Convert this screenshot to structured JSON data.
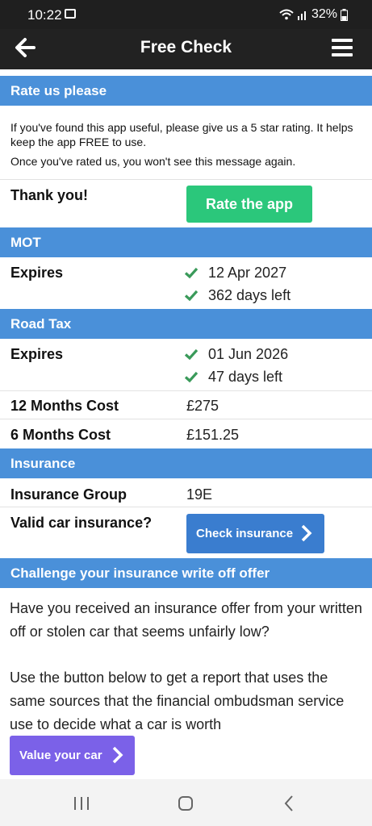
{
  "status_bar": {
    "time": "10:22",
    "battery": "32%"
  },
  "toolbar": {
    "title": "Free Check"
  },
  "rate": {
    "header": "Rate us please",
    "line1": "If you've found this app useful, please give us a 5 star rating. It helps keep the app FREE to use.",
    "line2": "Once you've rated us, you won't see this message again.",
    "thanks": "Thank you!",
    "button": "Rate the app"
  },
  "mot": {
    "header": "MOT",
    "expires_label": "Expires",
    "expiry_date": "12 Apr 2027",
    "days_left": "362 days left"
  },
  "road_tax": {
    "header": "Road Tax",
    "expires_label": "Expires",
    "expiry_date": "01 Jun 2026",
    "days_left": "47 days left",
    "cost12_label": "12 Months Cost",
    "cost12_value": "£275",
    "cost6_label": "6 Months Cost",
    "cost6_value": "£151.25"
  },
  "insurance": {
    "header": "Insurance",
    "group_label": "Insurance Group",
    "group_value": "19E",
    "valid_label": "Valid car insurance?",
    "button": "Check insurance"
  },
  "challenge": {
    "header": "Challenge your insurance write off offer",
    "para1": "Have you received an insurance offer from your written off or stolen car that seems unfairly low?",
    "para2": "Use the button below to get a report that uses the same sources that the financial ombudsman service use to decide what a car is worth",
    "button": "Value your car"
  },
  "colors": {
    "header_blue": "#4a90d9",
    "green": "#2bc77b",
    "check_green": "#3a9a5a",
    "purple": "#7b61e8",
    "button_blue": "#3a7dcf"
  }
}
